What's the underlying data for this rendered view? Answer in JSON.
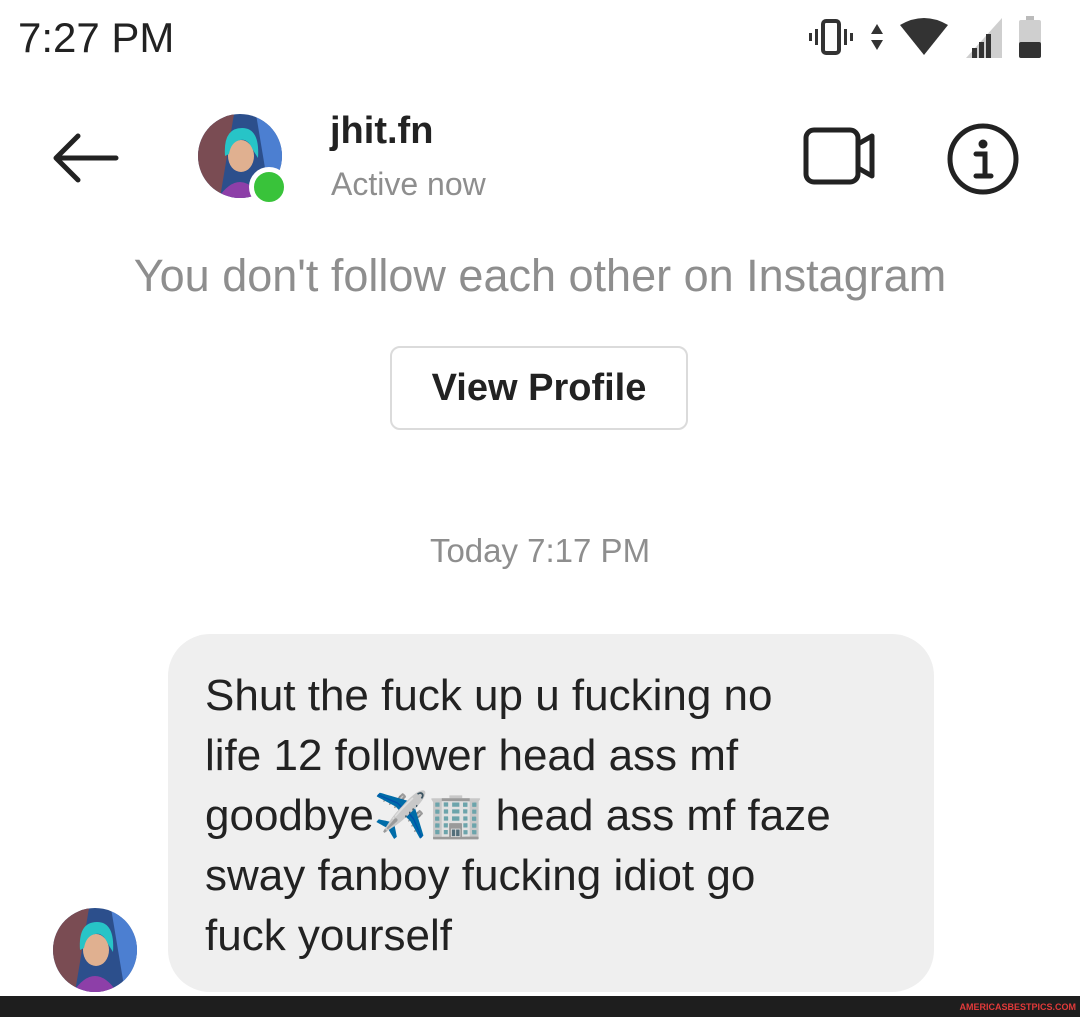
{
  "status_bar": {
    "time": "7:27 PM",
    "icons": [
      "vibrate-icon",
      "data-arrows-icon",
      "wifi-icon",
      "signal-icon",
      "battery-icon"
    ]
  },
  "header": {
    "username": "jhit.fn",
    "status": "Active now",
    "icons": [
      "back-arrow-icon",
      "video-call-icon",
      "info-icon"
    ],
    "online_color": "#39c33a"
  },
  "profile_prompt": {
    "notice": "You don't follow each other on Instagram",
    "button_label": "View Profile"
  },
  "thread": {
    "timestamp": "Today 7:17 PM",
    "messages": [
      {
        "lines": [
          "Shut the fuck up u fucking no",
          "life 12 follower head ass mf",
          "goodbye✈️🏢 head ass mf faze",
          "sway fanboy fucking idiot go",
          "fuck yourself"
        ]
      }
    ]
  },
  "watermark": "AMERICASBESTPICS.COM",
  "colors": {
    "secondary_text": "#8e8e8e",
    "bubble_bg": "#efefef",
    "button_border": "#dbdbdb"
  }
}
